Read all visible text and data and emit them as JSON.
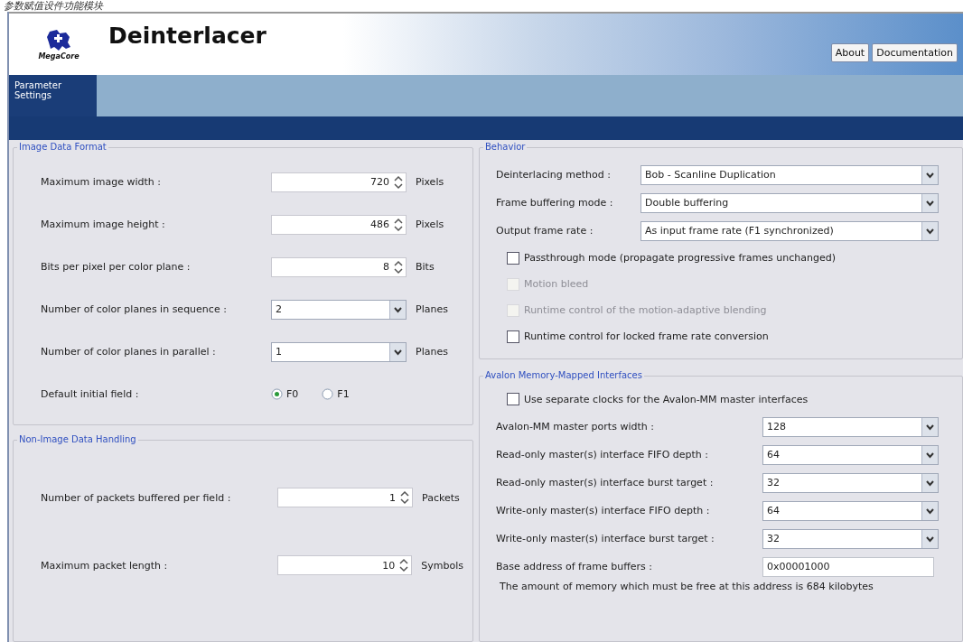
{
  "caption": "参数赋值设件功能模块",
  "header": {
    "logo_text": "MegaCore",
    "title": "Deinterlacer",
    "buttons": [
      "About",
      "Documentation"
    ]
  },
  "tabs": [
    {
      "label": "Parameter Settings",
      "selected": true
    }
  ],
  "left_groups": [
    {
      "title": "Image Data Format",
      "rows": [
        {
          "kind": "spin",
          "label": "Maximum image width :",
          "value": "720",
          "unit": "Pixels"
        },
        {
          "kind": "spin",
          "label": "Maximum image height :",
          "value": "486",
          "unit": "Pixels"
        },
        {
          "kind": "spin",
          "label": "Bits per pixel per color plane :",
          "value": "8",
          "unit": "Bits"
        },
        {
          "kind": "select",
          "label": "Number of color planes in sequence :",
          "value": "2",
          "unit": "Planes"
        },
        {
          "kind": "select",
          "label": "Number of color planes in parallel :",
          "value": "1",
          "unit": "Planes"
        },
        {
          "kind": "radio",
          "label": "Default initial field :",
          "options": [
            {
              "label": "F0",
              "selected": true
            },
            {
              "label": "F1",
              "selected": false
            }
          ]
        }
      ]
    },
    {
      "title": "Non-Image Data Handling",
      "rows": [
        {
          "kind": "spin",
          "label": "Number of packets buffered per field :",
          "value": "1",
          "unit": "Packets"
        },
        {
          "kind": "spin",
          "label": "Maximum packet length :",
          "value": "10",
          "unit": "Symbols"
        }
      ]
    }
  ],
  "behavior": {
    "title": "Behavior",
    "rows": [
      {
        "kind": "select",
        "label": "Deinterlacing method :",
        "value": "Bob - Scanline Duplication"
      },
      {
        "kind": "select",
        "label": "Frame buffering mode :",
        "value": "Double buffering"
      },
      {
        "kind": "select",
        "label": "Output frame rate :",
        "value": "As input frame rate (F1 synchronized)"
      }
    ],
    "checkboxes": [
      {
        "label": "Passthrough mode (propagate progressive frames unchanged)",
        "checked": false,
        "disabled": false
      },
      {
        "label": "Motion bleed",
        "checked": false,
        "disabled": true
      },
      {
        "label": "Runtime control of the motion-adaptive blending",
        "checked": false,
        "disabled": true
      },
      {
        "label": "Runtime control for locked frame rate conversion",
        "checked": false,
        "disabled": false
      }
    ]
  },
  "avalon": {
    "title": "Avalon Memory-Mapped Interfaces",
    "checkboxes": [
      {
        "label": "Use separate clocks for the Avalon-MM master interfaces",
        "checked": false,
        "disabled": false
      }
    ],
    "rows": [
      {
        "kind": "select",
        "label": "Avalon-MM master ports width :",
        "value": "128"
      },
      {
        "kind": "select",
        "label": "Read-only master(s) interface FIFO depth :",
        "value": "64"
      },
      {
        "kind": "select",
        "label": "Read-only master(s) interface burst target :",
        "value": "32"
      },
      {
        "kind": "select",
        "label": "Write-only master(s) interface FIFO depth :",
        "value": "64"
      },
      {
        "kind": "select",
        "label": "Write-only master(s) interface burst target :",
        "value": "32"
      },
      {
        "kind": "text",
        "label": "Base address of frame buffers :",
        "value": "0x00001000"
      }
    ],
    "note": "The amount of memory which must be free at this address is 684 kilobytes"
  }
}
